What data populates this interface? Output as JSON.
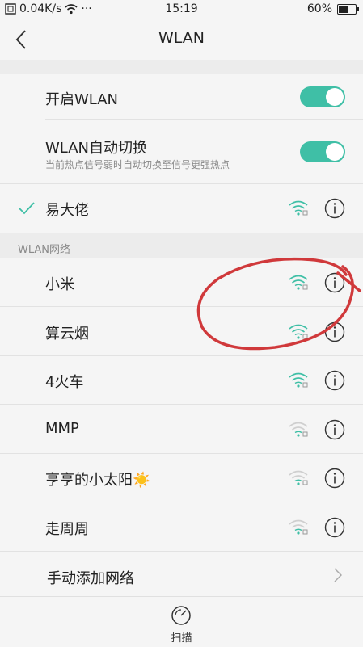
{
  "status_bar": {
    "speed": "0.04K/s",
    "dots": "···",
    "time": "15:19",
    "battery_percent": "60%",
    "battery_level": 0.6
  },
  "nav": {
    "title": "WLAN"
  },
  "settings": {
    "wlan_toggle_label": "开启WLAN",
    "wlan_toggle_on": true,
    "auto_switch_label": "WLAN自动切换",
    "auto_switch_sub": "当前热点信号弱时自动切换至信号更强热点",
    "auto_switch_on": true
  },
  "connected": {
    "name": "易大佬"
  },
  "networks_section": {
    "label": "WLAN网络"
  },
  "networks": [
    {
      "name": "小米"
    },
    {
      "name": "算云烟"
    },
    {
      "name": "4火车"
    },
    {
      "name": "MMP"
    },
    {
      "name": "亨亨的小太阳☀️"
    },
    {
      "name": "走周周"
    }
  ],
  "add_network": {
    "label": "手动添加网络"
  },
  "bottom": {
    "scan_label": "扫描"
  },
  "colors": {
    "accent": "#3fbfa6",
    "annotation": "#d0393b"
  },
  "icons": [
    "back-icon",
    "wifi-icon",
    "info-icon",
    "check-icon",
    "chevron-right-icon",
    "scan-icon",
    "battery-icon"
  ]
}
